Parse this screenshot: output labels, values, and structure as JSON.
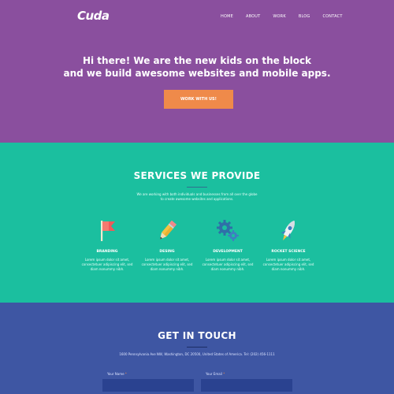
{
  "brand": {
    "logo": "Cuda"
  },
  "nav": {
    "items": [
      "HOME",
      "ABOUT",
      "WORK",
      "BLOG",
      "CONTACT"
    ]
  },
  "hero": {
    "line1": "Hi there! We are the new kids on the block",
    "line2": "and we build awesome websites and mobile apps.",
    "cta": "WORK WITH US!"
  },
  "services": {
    "title": "SERVICES WE PROVIDE",
    "desc1": "We are working with both individuals and businesses from all over the globe",
    "desc2": "to create awesome websites and applications.",
    "items": [
      {
        "title": "BRANDING",
        "desc1": "Lorem ipsum dolor sit amet,",
        "desc2": "consectetuer adipiscing elit, sed",
        "desc3": "diam nonummy nibh.",
        "icon": "flag-icon"
      },
      {
        "title": "DESING",
        "desc1": "Lorem ipsum dolor sit amet,",
        "desc2": "consectetuer adipiscing elit, sed",
        "desc3": "diam nonummy nibh.",
        "icon": "pencil-icon"
      },
      {
        "title": "DEVELOPMENT",
        "desc1": "Lorem ipsum dolor sit amet,",
        "desc2": "consectetuer adipiscing elit, sed",
        "desc3": "diam nonummy nibh.",
        "icon": "gears-icon"
      },
      {
        "title": "ROCKET SCIENCE",
        "desc1": "Lorem ipsum dolor sit amet,",
        "desc2": "consectetuer adipiscing elit, sed",
        "desc3": "diam nonummy nibh.",
        "icon": "rocket-icon"
      }
    ]
  },
  "contact": {
    "title": "GET IN TOUCH",
    "address": "1600 Pennsylvania Ave NW, Washington, DC 20500, United States of America. Tel: (202) 456-1111",
    "name_label": "Your Name",
    "email_label": "Your Email",
    "required_mark": "*"
  },
  "colors": {
    "hero_bg": "#8a4f9e",
    "accent": "#ef8a4a",
    "services_bg": "#1bbf9f",
    "contact_bg": "#3e56a3"
  }
}
